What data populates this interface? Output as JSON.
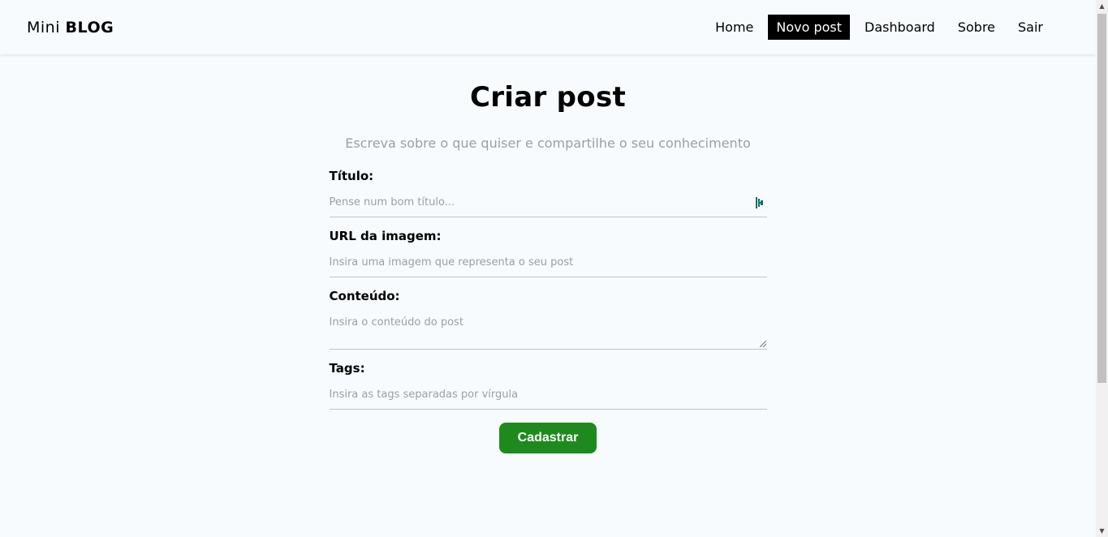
{
  "navbar": {
    "brand_light": "Mini",
    "brand_bold": "BLOG",
    "links": [
      {
        "label": "Home"
      },
      {
        "label": "Novo post"
      },
      {
        "label": "Dashboard"
      },
      {
        "label": "Sobre"
      },
      {
        "label": "Sair"
      }
    ],
    "active": "Novo post"
  },
  "main": {
    "title": "Criar post",
    "subtitle": "Escreva sobre o que quiser e compartilhe o seu conhecimento"
  },
  "form": {
    "title_field": {
      "label": "Título:",
      "placeholder": "Pense num bom título...",
      "value": ""
    },
    "image_field": {
      "label": "URL da imagem:",
      "placeholder": "Insira uma imagem que representa o seu post",
      "value": ""
    },
    "content_field": {
      "label": "Conteúdo:",
      "placeholder": "Insira o conteúdo do post",
      "value": ""
    },
    "tags_field": {
      "label": "Tags:",
      "placeholder": "Insira as tags separadas por vírgula",
      "value": ""
    },
    "submit_label": "Cadastrar"
  },
  "icons": {
    "password_manager": "password-manager-icon",
    "textarea_resize": "resize-grip-icon",
    "scroll_up": "scroll-up-arrow-icon",
    "scroll_down": "scroll-down-arrow-icon"
  },
  "colors": {
    "background": "#f7fbfd",
    "active_nav_bg": "#000000",
    "submit_button": "#1e8a1e",
    "placeholder": "#9aa0a3",
    "icon_teal": "#1a6b6b"
  }
}
